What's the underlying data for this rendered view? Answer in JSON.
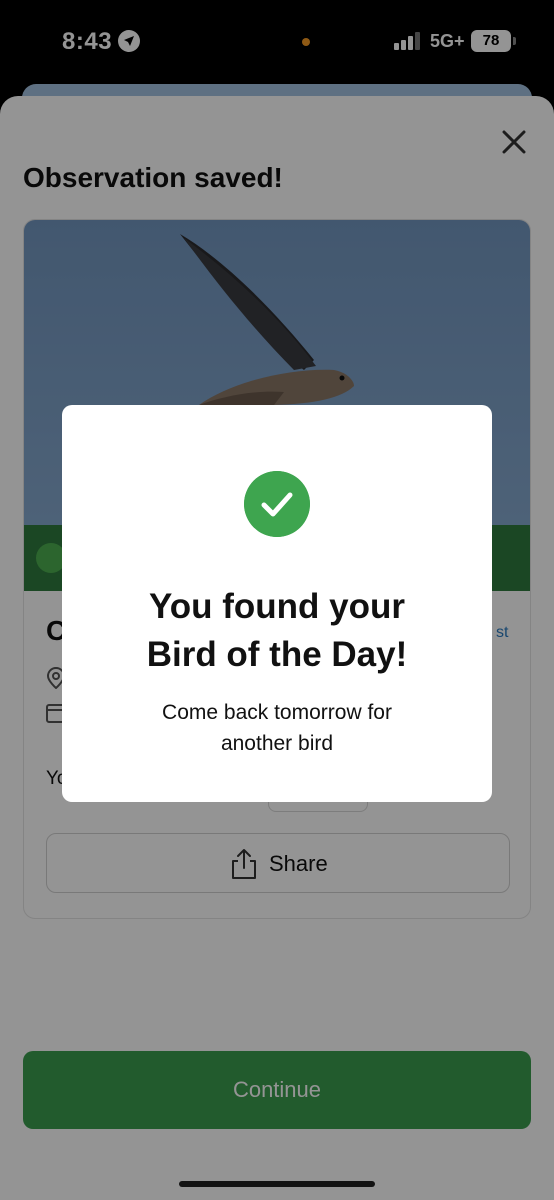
{
  "status_bar": {
    "time": "8:43",
    "network": "5G+",
    "battery": "78"
  },
  "sheet": {
    "title": "Observation saved!"
  },
  "card": {
    "species_initial": "C",
    "list_link": "st",
    "you_text": "Yo",
    "share_label": "Share"
  },
  "continue_label": "Continue",
  "modal": {
    "title_line1": "You found your",
    "title_line2": "Bird of the Day!",
    "subtitle_line1": "Come back tomorrow for",
    "subtitle_line2": "another bird"
  },
  "colors": {
    "accent_green": "#3ea54f",
    "dark_green": "#2f7a3e",
    "button_green": "#3b9e4f"
  }
}
